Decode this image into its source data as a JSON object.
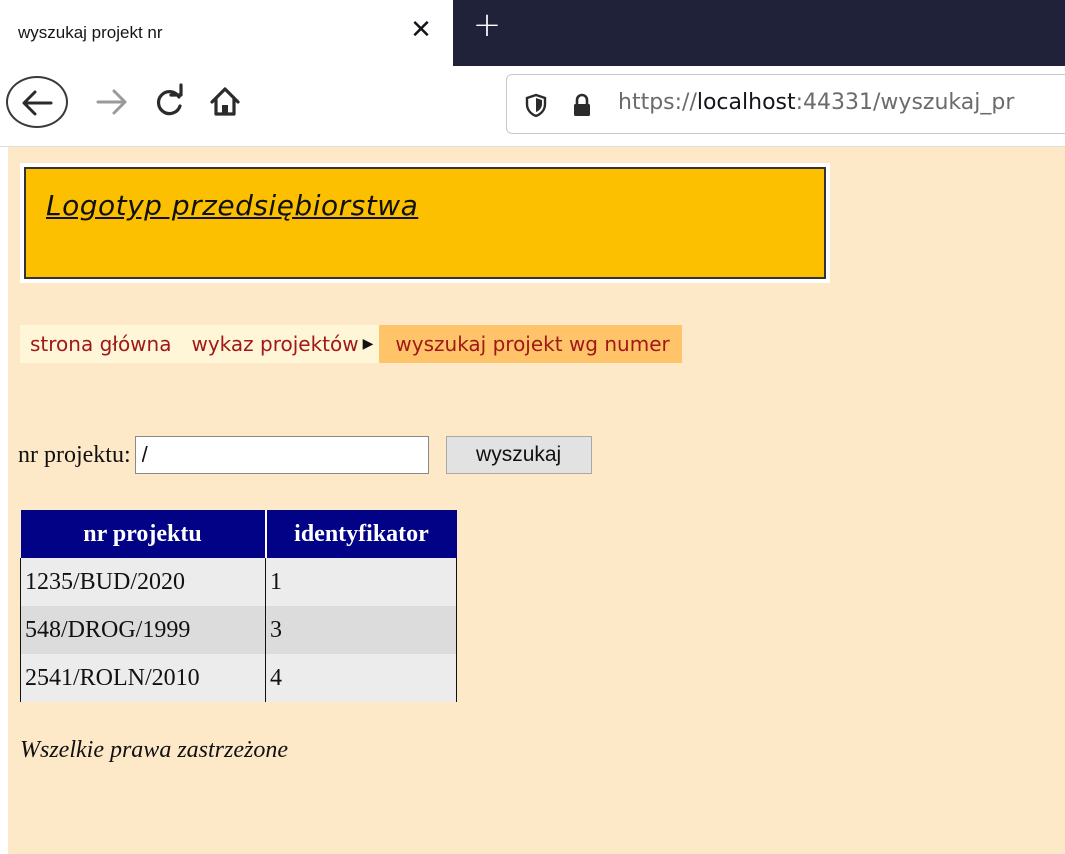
{
  "browser": {
    "tab": {
      "title": "wyszukaj projekt nr",
      "close_glyph": "✕"
    },
    "new_tab_glyph": "+",
    "url": {
      "scheme": "https://",
      "host": "localhost",
      "rest": ":44331/wyszukaj_pr"
    }
  },
  "header": {
    "logo_text": "Logotyp przedsiębiorstwa"
  },
  "breadcrumb": {
    "items": [
      "strona główna",
      "wykaz projektów"
    ],
    "separator_glyph": "▶",
    "current": "wyszukaj projekt wg numer"
  },
  "search": {
    "label": "nr projektu:",
    "value": "/",
    "button_label": "wyszukaj"
  },
  "results": {
    "columns": [
      "nr projektu",
      "identyfikator"
    ],
    "rows": [
      [
        "1235/BUD/2020",
        "1"
      ],
      [
        "548/DROG/1999",
        "3"
      ],
      [
        "2541/ROLN/2010",
        "4"
      ]
    ]
  },
  "footer": {
    "text": "Wszelkie prawa zastrzeżone"
  },
  "colors": {
    "page_background": "#fde8c8",
    "logo_background": "#fcc000",
    "table_header": "#020286",
    "breadcrumb_text": "#a01818",
    "breadcrumb_current": "#ffc36a"
  },
  "icons": [
    "back-arrow-icon",
    "forward-arrow-icon",
    "reload-icon",
    "home-icon",
    "shield-icon",
    "lock-icon"
  ]
}
